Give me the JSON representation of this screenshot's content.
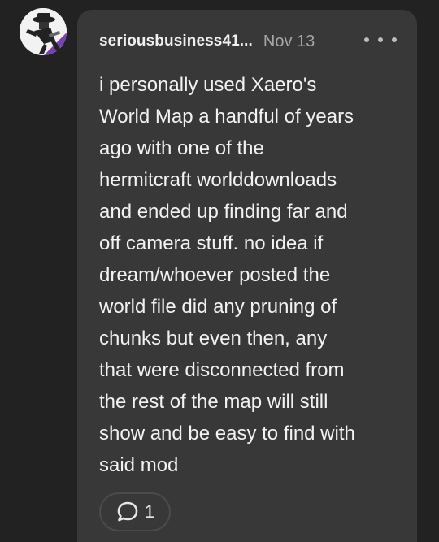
{
  "post": {
    "username": "seriousbusiness41...",
    "date": "Nov 13",
    "body_lines": [
      "i personally used Xaero's",
      "World Map a handful of years",
      "ago with one of the",
      "hermitcraft worlddownloads",
      "and ended up finding far and",
      "off camera stuff. no idea if",
      "dream/whoever posted the",
      "world file did any pruning of",
      "chunks but even then, any",
      "that were disconnected from",
      "the rest of the map will still",
      "show and be easy to find with",
      "said mod"
    ],
    "reply_count": "1"
  },
  "icons": {
    "avatar": "avatar-illustration",
    "more": "more-options-icon",
    "reply": "reply-bubble-icon"
  },
  "colors": {
    "background": "#222222",
    "card": "#383838",
    "text": "#f2f2f2",
    "muted": "#a6a6a6",
    "avatar_accent": "#7a3fb0"
  }
}
